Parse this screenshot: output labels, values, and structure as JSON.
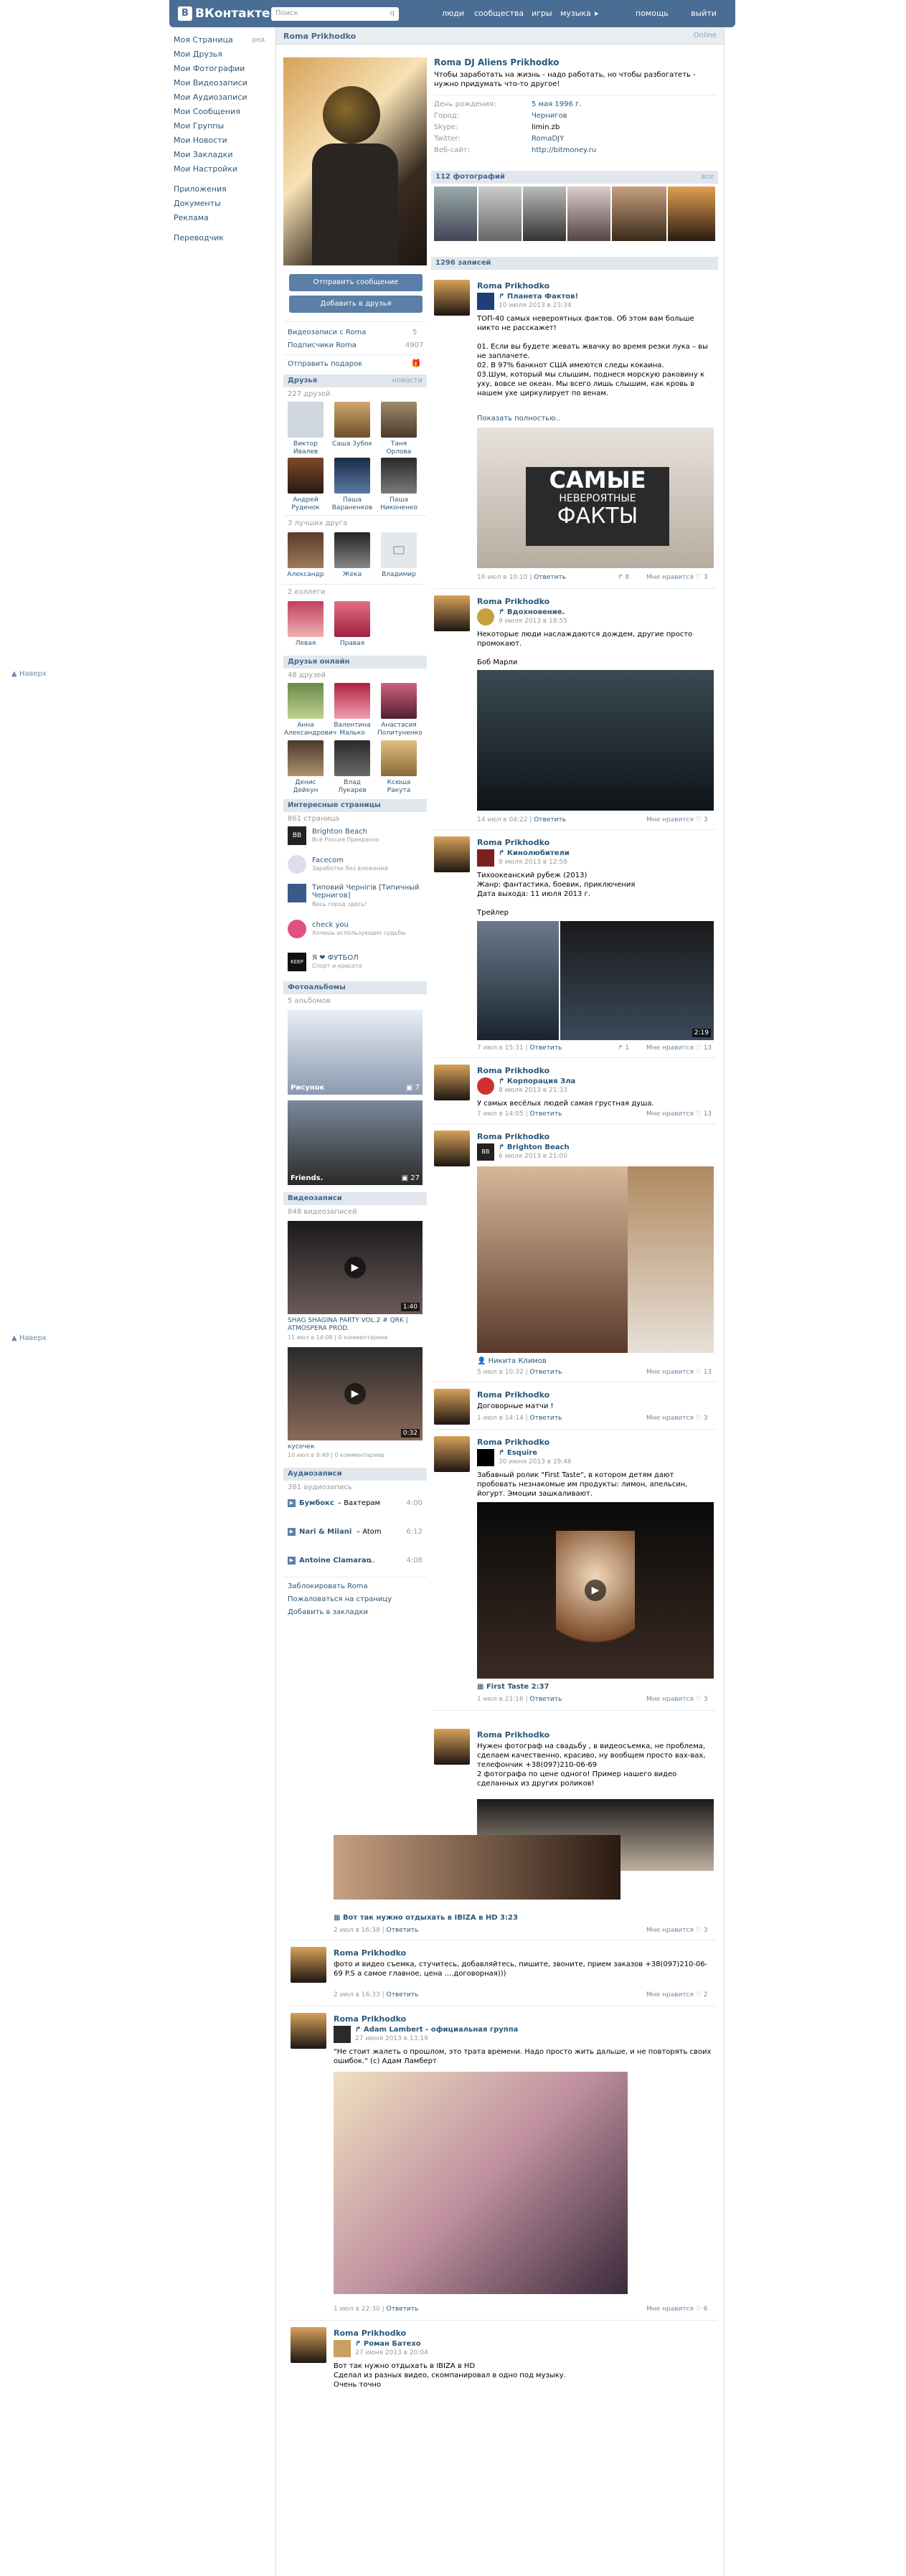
{
  "topbar": {
    "logo": "ВКонтакте",
    "logo_letter": "В",
    "search_placeholder": "Поиск",
    "search_hint": "q",
    "nav": [
      "люди",
      "сообщества",
      "игры",
      "музыка",
      "помощь",
      "выйти"
    ]
  },
  "left_menu": {
    "items": [
      "Моя Страница",
      "Мои Друзья",
      "Мои Фотографии",
      "Мои Видеозаписи",
      "Мои Аудиозаписи",
      "Мои Сообщения",
      "Мои Группы",
      "Мои Новости",
      "Мои Закладки",
      "Мои Настройки"
    ],
    "edit": "ред.",
    "extra": [
      "Приложения",
      "Документы",
      "Реклама"
    ],
    "transfers": "Переводчик",
    "scroll_up": "Наверх"
  },
  "header": {
    "title": "Roma Prikhodko",
    "online": "Online"
  },
  "profile": {
    "name": "Roma DJ Aliens Prikhodko",
    "status": "Чтобы заработать на жизнь - надо работать, но чтобы разбогатеть - нужно придумать что-то другое!",
    "fields": [
      {
        "k": "День рождения:",
        "v": "5 мая 1996 г."
      },
      {
        "k": "Город:",
        "v": "Чернигов"
      },
      {
        "k": "Skype:",
        "v": "limin.zb"
      },
      {
        "k": "Twitter:",
        "v": "RomaDJY"
      },
      {
        "k": "Веб-сайт:",
        "v": "http://bitmoney.ru"
      }
    ],
    "send_message": "Отправить сообщение",
    "add_friend": "Добавить в друзья",
    "counters": [
      {
        "k": "Видеозаписи с Roma",
        "v": "5"
      },
      {
        "k": "Подписчики Roma",
        "v": "4907"
      }
    ],
    "send_gift": "Отправить подарок"
  },
  "friends": {
    "title": "Друзья",
    "count": "227 друзей",
    "link": "новости",
    "list": [
      {
        "n": "Виктор Ивалев"
      },
      {
        "n": "Саша Зубок"
      },
      {
        "n": "Таня Орлова"
      },
      {
        "n": "Андрей Руденок"
      },
      {
        "n": "Паша Вараненков"
      },
      {
        "n": "Паша Никоненко"
      }
    ]
  },
  "best_friends": {
    "title": "3 лучших друга",
    "list": [
      "Александр",
      "Жека",
      "Владимир"
    ]
  },
  "colleagues": {
    "title": "2 коллеги",
    "list": [
      "Левая",
      "Правая"
    ]
  },
  "online_friends": {
    "title": "Друзья онлайн",
    "count": "48 друзей",
    "list": [
      "Анна Александрович",
      "Валентина Малько",
      "Анастасия Политуненко",
      "Денис Дейкун",
      "Влад Лукарев",
      "Ксюша Ракута"
    ]
  },
  "pages": {
    "title": "Интересные страницы",
    "count": "861 страница",
    "list": [
      {
        "n": "Brighton Beach",
        "d": "Всё Россия Прекрасно"
      },
      {
        "n": "Facecom",
        "d": "Заработок без вложений"
      },
      {
        "n": "Типовий Чернігів [Типичный Чернигов]",
        "d": "Весь город здесь!"
      },
      {
        "n": "check you",
        "d": "Хочешь использующих судьбы"
      },
      {
        "n": "Я ❤ ФУТБОЛ",
        "d": "Спорт и красота"
      }
    ]
  },
  "albums": {
    "title": "Фотоальбомы",
    "count": "5 альбомов",
    "list": [
      {
        "n": "Рисунок",
        "c": "7"
      },
      {
        "n": "Friends.",
        "c": "27"
      }
    ]
  },
  "videos": {
    "title": "Видеозаписи",
    "count": "848 видеозаписей",
    "list": [
      {
        "t": "SHAG SHAGINA PARTY VOL.2 # QRK | ATMOSPERA PROD.",
        "d": "1:40",
        "m": "11 июл в 14:08 | 0 комментариев"
      },
      {
        "t": "кусочек",
        "d": "0:32",
        "m": "10 июл в 9:49 | 0 комментариев"
      }
    ]
  },
  "audio": {
    "title": "Аудиозаписи",
    "count": "381 аудиозапись",
    "list": [
      {
        "a": "Бумбокс",
        "t": "Вахтерам",
        "d": "4:00"
      },
      {
        "a": "Nari & Milani",
        "t": "Atom",
        "d": "6:12"
      },
      {
        "a": "Antoine Clamaran",
        "t": "...",
        "d": "4:08"
      }
    ]
  },
  "bottom_links": [
    "Заблокировать Roma",
    "Пожаловаться на страницу",
    "Добавить в закладки"
  ],
  "photos": {
    "title": "112 фотографий",
    "link": "все"
  },
  "wall": {
    "title": "1296 записей"
  },
  "posts": [
    {
      "author": "Roma Prikhodko",
      "repost": "Планета Фактов!",
      "date": "10 июля 2013 в 23:34",
      "text": "ТОП-40 самых невероятных фактов. Об этом вам больше никто не расскажет!\n\n01. Если вы будете жевать жвачку во время резки лука – вы не заплачете.\n02. В 97% банкнот США имеются следы кокаина.\n03.Шум, который мы слышим, поднеся морскую раковину к уху, вовсе не океан. Мы всего лишь слышим, как кровь в нашем ухе циркулирует по венам.",
      "more": "Показать полностью..",
      "image_text": [
        "САМЫЕ",
        "НЕВЕРОЯТНЫЕ",
        "ФАКТЫ"
      ],
      "meta": "16 июл в 10:10",
      "reply": "Ответить",
      "reposts": "8",
      "likes": "Мне нравится ♡ 3"
    },
    {
      "author": "Roma Prikhodko",
      "repost": "Вдохновение.",
      "date": "9 июля 2013 в 18:55",
      "text": "Некоторые люди наслаждаются дождем, другие просто промокают.\n\nБоб Марли",
      "meta": "14 июл в 04:22",
      "reply": "Ответить",
      "likes": "Мне нравится ♡ 3"
    },
    {
      "author": "Roma Prikhodko",
      "repost": "Кинолюбители",
      "date": "9 июля 2013 в 12:59",
      "text": "Тихоокеанский рубеж (2013)\nЖанр: фантастика, боевик, приключения\nДата выхода: 11 июля 2013 г.\n\nТрейлер",
      "dur": "2:19",
      "meta": "7 июл в 15:31",
      "reply": "Ответить",
      "reposts": "1",
      "likes": "Мне нравится ♡ 13"
    },
    {
      "author": "Roma Prikhodko",
      "repost": "Корпорация Зла",
      "date": "8 июля 2013 в 21:33",
      "text": "У самых весёлых людей самая грустная душа.",
      "meta": "7 июл в 14:05",
      "reply": "Ответить",
      "likes": "Мне нравится ♡ 13"
    },
    {
      "author": "Roma Prikhodko",
      "repost": "Brighton Beach",
      "date": "6 июля 2013 в 21:00",
      "tag": "Никита Климов",
      "meta": "5 июл в 10:32",
      "reply": "Ответить",
      "likes": "Мне нравится ♡ 13"
    },
    {
      "author": "Roma Prikhodko",
      "text": "Договорные матчи !",
      "meta": "1 июл в 14:14",
      "reply": "Ответить",
      "likes": "Мне нравится ♡ 3"
    },
    {
      "author": "Roma Prikhodko",
      "repost": "Esquire",
      "date": "30 июня 2013 в 19:46",
      "text": "Забавный ролик \"First Taste\", в котором детям дают пробовать незнакомые им продукты: лимон, апельсин, йогурт. Эмоции зашкаливают.",
      "video": "First Taste 2:37",
      "meta": "1 июл в 21:16",
      "reply": "Ответить",
      "likes": "Мне нравится ♡ 3"
    },
    {
      "author": "Roma Prikhodko",
      "text": "Нужен фотограф на свадьбу , в видеосъемка, не проблема, сделаем качественно, красиво, ну вообщем просто вах-вах, телефончик +38(097)210-06-69\n2 фотографа по цене одного! Пример нашего видео сделанных из других роликов!",
      "video": "Вот так нужно отдыхать в IBIZA в HD 3:23",
      "meta": "2 июл в 16:38",
      "reply": "Ответить",
      "likes": "Мне нравится ♡ 3"
    },
    {
      "author": "Roma Prikhodko",
      "text": "фото и видео съемка, стучитесь, добавляйтесь, пишите, звоните, прием заказов +38(097)210-06-69 P.S а самое главное, цена ....договорная)))",
      "meta": "2 июл в 16:33",
      "reply": "Ответить",
      "likes": "Мне нравится ♡ 2"
    },
    {
      "author": "Roma Prikhodko",
      "repost": "Adam Lambert - официальная группа",
      "date": "27 июня 2013 в 13:19",
      "text": "\"Не стоит жалеть о прошлом, это трата времени. Надо просто жить дальше, и не повторять своих ошибок.\" (с) Адам Ламберт",
      "meta": "1 июл в 22:30",
      "reply": "Ответить",
      "likes": "Мне нравится ♡ 6"
    },
    {
      "author": "Roma Prikhodko",
      "repost": "Роман Батехо",
      "date": "27 июня 2013 в 20:04",
      "text": "Вот так нужно отдыхать в IBIZA в HD\nСделал из разных видео, скомпанировал в одно под музыку.\nОчень точно"
    }
  ],
  "colors": {
    "accent": "#4a6d94",
    "link": "#2b587a",
    "section": "#e1e7ed"
  }
}
